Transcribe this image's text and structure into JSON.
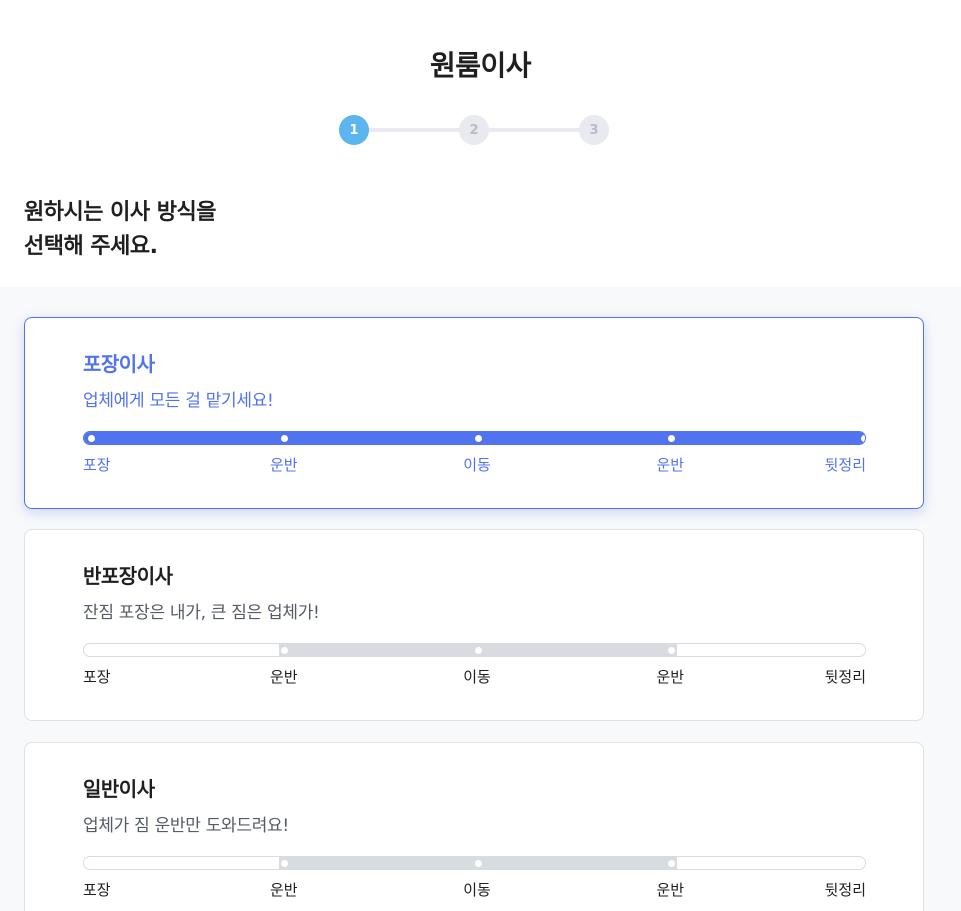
{
  "header": {
    "title": "원룸이사"
  },
  "stepper": {
    "steps": [
      "1",
      "2",
      "3"
    ],
    "active": 1
  },
  "headline": {
    "line1": "원하시는 이사 방식을",
    "line2": "선택해 주세요."
  },
  "colors": {
    "accent": "#5273f0",
    "step_active": "#5db5f0",
    "inactive_bar": "#d8dbe0"
  },
  "stages": [
    "포장",
    "운반",
    "이동",
    "운반",
    "뒷정리"
  ],
  "options": [
    {
      "title": "포장이사",
      "desc": "업체에게 모든 걸 맡기세요!",
      "selected": true,
      "service_range": [
        0,
        4
      ]
    },
    {
      "title": "반포장이사",
      "desc": "잔짐 포장은 내가, 큰 짐은 업체가!",
      "selected": false,
      "service_range": [
        1,
        3
      ]
    },
    {
      "title": "일반이사",
      "desc": "업체가 짐 운반만 도와드려요!",
      "selected": false,
      "service_range": [
        1,
        3
      ]
    }
  ]
}
